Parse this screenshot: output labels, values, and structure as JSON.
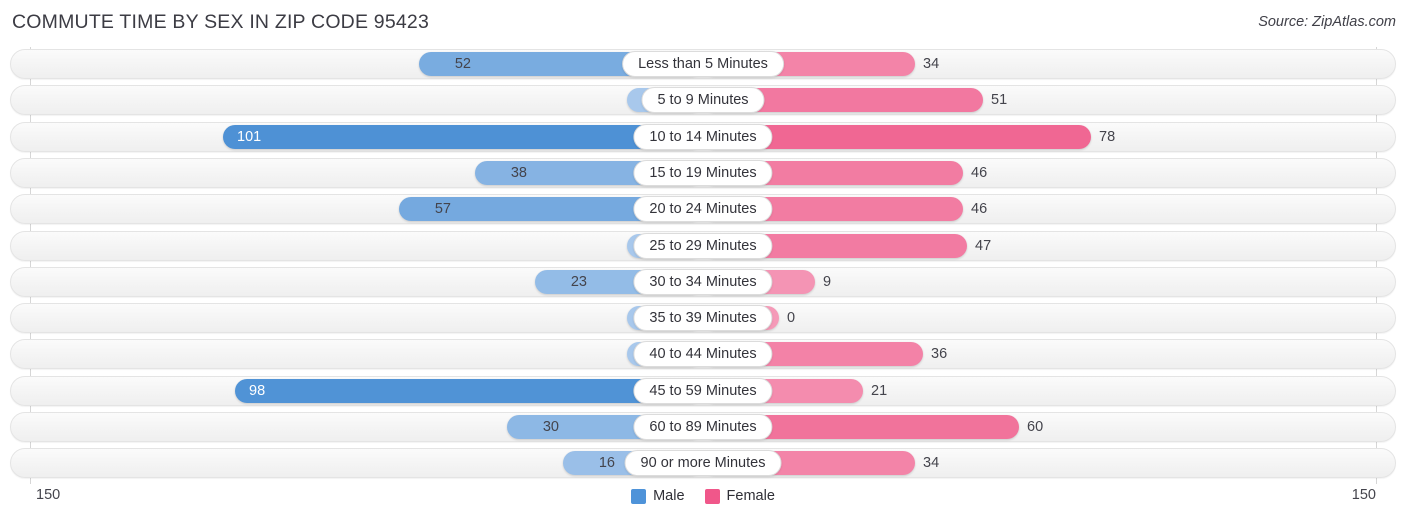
{
  "header": {
    "title": "COMMUTE TIME BY SEX IN ZIP CODE 95423",
    "source": "Source: ZipAtlas.com"
  },
  "axis": {
    "left_cap": "150",
    "right_cap": "150",
    "max": 150
  },
  "legend": {
    "items": [
      {
        "label": "Male",
        "color": "#4e93d9"
      },
      {
        "label": "Female",
        "color": "#f0578a"
      }
    ]
  },
  "colors": {
    "male_strong": "#4a8fd4",
    "male_light": "#a8c8ec",
    "female_strong": "#ee5586",
    "female_light": "#f59ab8",
    "track": "#f4f4f4",
    "axis": "#d6d6d6"
  },
  "chart_data": {
    "type": "bar",
    "title": "COMMUTE TIME BY SEX IN ZIP CODE 95423",
    "subtitle": "",
    "xlabel": "",
    "ylabel": "",
    "orientation": "horizontal-diverging",
    "grid": false,
    "legend_position": "bottom-center",
    "xlim": [
      0,
      150
    ],
    "axis_tick_labels": [
      "150",
      "150"
    ],
    "categories": [
      "Less than 5 Minutes",
      "5 to 9 Minutes",
      "10 to 14 Minutes",
      "15 to 19 Minutes",
      "20 to 24 Minutes",
      "25 to 29 Minutes",
      "30 to 34 Minutes",
      "35 to 39 Minutes",
      "40 to 44 Minutes",
      "45 to 59 Minutes",
      "60 to 89 Minutes",
      "90 or more Minutes"
    ],
    "series": [
      {
        "name": "Male",
        "color": "#4e93d9",
        "side": "left",
        "values": [
          52,
          0,
          101,
          38,
          57,
          0,
          23,
          0,
          0,
          98,
          30,
          16
        ]
      },
      {
        "name": "Female",
        "color": "#f0578a",
        "side": "right",
        "values": [
          34,
          51,
          78,
          46,
          46,
          47,
          9,
          0,
          36,
          21,
          60,
          34
        ]
      }
    ]
  }
}
